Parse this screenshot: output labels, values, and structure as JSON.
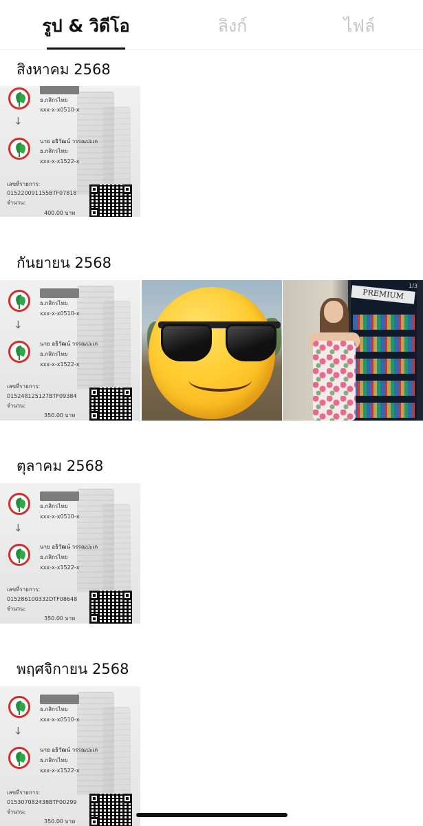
{
  "tabs": [
    {
      "label": "รูป & วิดีโอ",
      "active": true
    },
    {
      "label": "ลิงก์",
      "active": false
    },
    {
      "label": "ไฟล์",
      "active": false
    }
  ],
  "sections": [
    {
      "title": "สิงหาคม 2568",
      "receipt": {
        "from_bank": "ธ.กสิกรไทย",
        "from_account": "xxx-x-x0510-x",
        "to_name": "นาย อธิวัฒน์ วรรณปะเก",
        "to_bank": "ธ.กสิกรไทย",
        "to_account": "xxx-x-x1522-x",
        "ref_label": "เลขที่รายการ:",
        "ref_no": "015220091155BTF07818",
        "amount_label": "จำนวน:",
        "amount": "400.00 บาท"
      }
    },
    {
      "title": "กันยายน 2568",
      "receipt": {
        "from_bank": "ธ.กสิกรไทย",
        "from_account": "xxx-x-x0510-x",
        "to_name": "นาย อธิวัฒน์ วรรณปะเก",
        "to_bank": "ธ.กสิกรไทย",
        "to_account": "xxx-x-x1522-x",
        "ref_label": "เลขที่รายการ:",
        "ref_no": "015248125127BTF09384",
        "amount_label": "จำนวน:",
        "amount": "350.00 บาท"
      },
      "photo_badge": "1/3",
      "photo_sign": "PREMIUM"
    },
    {
      "title": "ตุลาคม 2568",
      "receipt": {
        "from_bank": "ธ.กสิกรไทย",
        "from_account": "xxx-x-x0510-x",
        "to_name": "นาย อธิวัฒน์ วรรณปะเก",
        "to_bank": "ธ.กสิกรไทย",
        "to_account": "xxx-x-x1522-x",
        "ref_label": "เลขที่รายการ:",
        "ref_no": "015286100332DTF08648",
        "amount_label": "จำนวน:",
        "amount": "350.00 บาท"
      }
    },
    {
      "title": "พฤศจิกายน 2568",
      "receipt": {
        "from_bank": "ธ.กสิกรไทย",
        "from_account": "xxx-x-x0510-x",
        "to_name": "นาย อธิวัฒน์ วรรณปะเก",
        "to_bank": "ธ.กสิกรไทย",
        "to_account": "xxx-x-x1522-x",
        "ref_label": "เลขที่รายการ:",
        "ref_no": "015307082438BTF00299",
        "amount_label": "จำนวน:",
        "amount": "350.00 บาท"
      }
    }
  ]
}
